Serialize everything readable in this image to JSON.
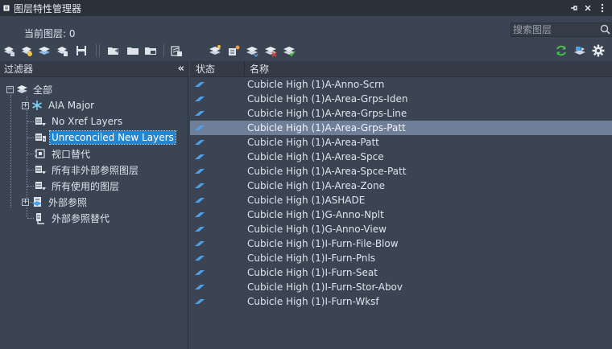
{
  "window": {
    "title": "图层特性管理器",
    "pin_icon": "pin-icon",
    "close_icon": "close-icon",
    "menu_icon": "menu-icon"
  },
  "current_layer": "当前图层: 0",
  "search": {
    "placeholder": "搜索图层"
  },
  "toolbar": {
    "left_icons": [
      "new-property-filter-icon",
      "new-group-filter-icon",
      "layer-states-icon",
      "layer-state-icon",
      "save-icon",
      "new-layer-icon",
      "layer-folder-icon",
      "layer-vp-icon",
      "layer-settings-icon"
    ],
    "mid_icons": [
      "new-layer-vp-frozen-icon",
      "layer-vp-freeze-icon",
      "layer-merge-icon",
      "delete-layer-icon",
      "set-current-icon"
    ],
    "right_icons": [
      "refresh-icon",
      "layer-translate-icon",
      "settings-gear-icon"
    ]
  },
  "filter_pane": {
    "header": "过滤器",
    "collapse": "«",
    "tree": [
      {
        "label": "全部",
        "icon": "all-layers-icon"
      },
      {
        "label": "AIA Major",
        "icon": "property-filter-icon"
      },
      {
        "label": "No Xref Layers",
        "icon": "filter-layers-icon"
      },
      {
        "label": "Unreconciled New Layers",
        "icon": "unreconciled-icon"
      },
      {
        "label": "视口替代",
        "icon": "viewport-override-icon"
      },
      {
        "label": "所有非外部参照图层",
        "icon": "filter-layers-icon"
      },
      {
        "label": "所有使用的图层",
        "icon": "filter-layers-icon"
      },
      {
        "label": "外部参照",
        "icon": "xref-icon"
      },
      {
        "label": "外部参照替代",
        "icon": "xref-override-icon"
      }
    ]
  },
  "layer_table": {
    "columns": [
      "状态",
      "名称"
    ],
    "rows": [
      "Cubicle High (1)A-Anno-Scrn",
      "Cubicle High (1)A-Area-Grps-Iden",
      "Cubicle High (1)A-Area-Grps-Line",
      "Cubicle High (1)A-Area-Grps-Patt",
      "Cubicle High (1)A-Area-Patt",
      "Cubicle High (1)A-Area-Spce",
      "Cubicle High (1)A-Area-Spce-Patt",
      "Cubicle High (1)A-Area-Zone",
      "Cubicle High (1)ASHADE",
      "Cubicle High (1)G-Anno-Nplt",
      "Cubicle High (1)G-Anno-View",
      "Cubicle High (1)I-Furn-File-Blow",
      "Cubicle High (1)I-Furn-Pnls",
      "Cubicle High (1)I-Furn-Seat",
      "Cubicle High (1)I-Furn-Stor-Abov",
      "Cubicle High (1)I-Furn-Wksf"
    ],
    "selected_index": 3
  },
  "colors": {
    "accent": "#1f88d6",
    "selected_row": "#6f7f9a",
    "status_icon": "#4aa3e8"
  }
}
